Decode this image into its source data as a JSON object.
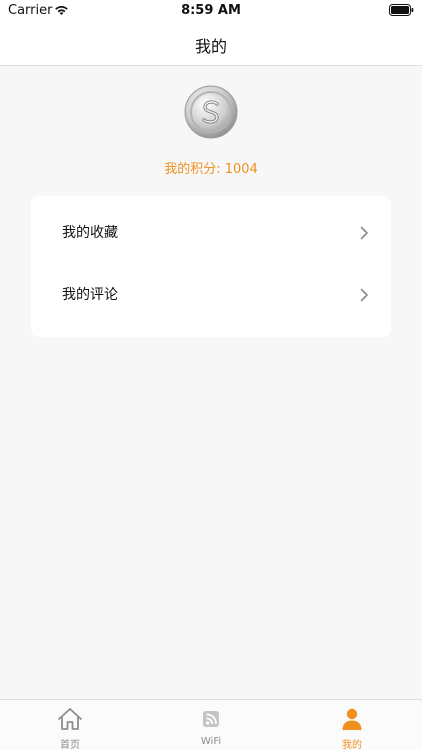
{
  "status_bar": {
    "carrier": "Carrier",
    "time": "8:59 AM"
  },
  "nav": {
    "title": "我的"
  },
  "profile": {
    "points_text": "我的积分: 1004",
    "coin_icon": "coin-s-icon"
  },
  "menu": {
    "items": [
      {
        "label": "我的收藏",
        "icon": "chevron-right-icon"
      },
      {
        "label": "我的评论",
        "icon": "chevron-right-icon"
      }
    ]
  },
  "tabs": [
    {
      "label": "首页",
      "icon": "home-icon",
      "active": false
    },
    {
      "label": "WiFi",
      "icon": "wifi-icon",
      "active": false
    },
    {
      "label": "我的",
      "icon": "person-icon",
      "active": true
    }
  ],
  "colors": {
    "accent": "#f0901f",
    "inactive": "#8e8e8e"
  }
}
